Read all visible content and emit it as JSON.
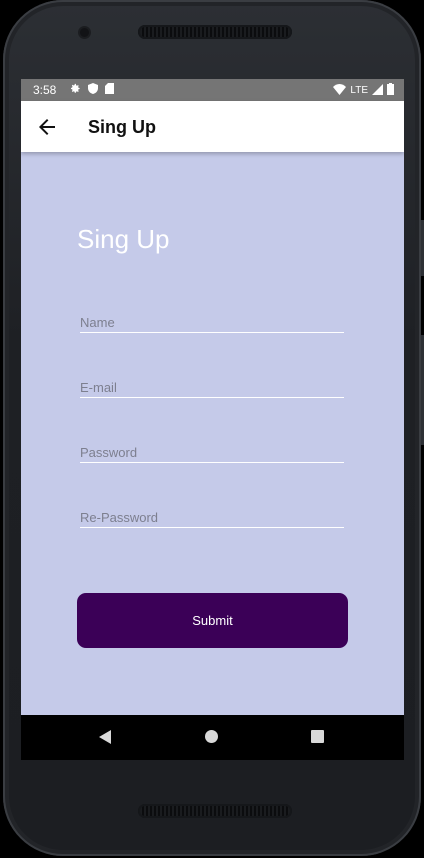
{
  "status_bar": {
    "time": "3:58",
    "network": "LTE",
    "icons_left": [
      "gear-icon",
      "shield-icon",
      "sd-card-icon"
    ],
    "icons_right": [
      "wifi-icon",
      "signal-icon",
      "battery-icon"
    ]
  },
  "app_bar": {
    "title": "Sing Up",
    "back_icon": "arrow-left-icon"
  },
  "form": {
    "heading": "Sing Up",
    "fields": [
      {
        "placeholder": "Name",
        "value": ""
      },
      {
        "placeholder": "E-mail",
        "value": ""
      },
      {
        "placeholder": "Password",
        "value": ""
      },
      {
        "placeholder": "Re-Password",
        "value": ""
      }
    ],
    "submit_label": "Submit"
  },
  "nav_bar": {
    "buttons": [
      "back-icon",
      "home-icon",
      "recents-icon"
    ]
  },
  "colors": {
    "background": "#c5cae9",
    "button": "#3b0057",
    "status_bar": "#757575",
    "app_bar": "#ffffff"
  }
}
